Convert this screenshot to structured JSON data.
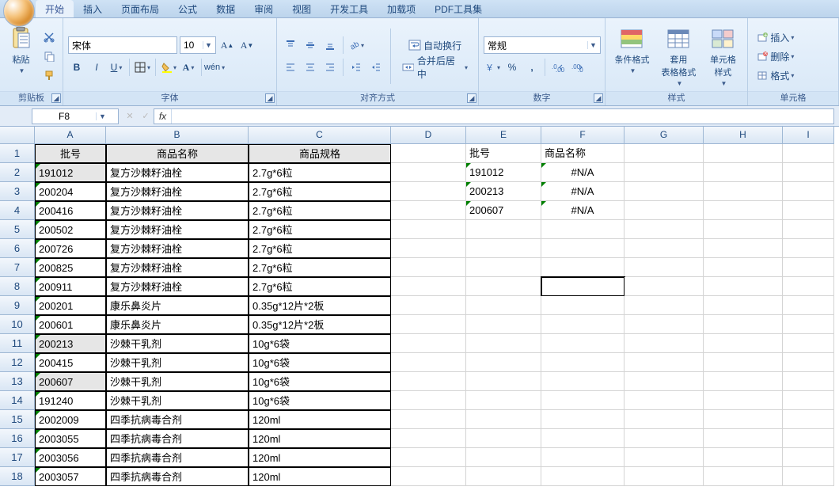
{
  "tabs": [
    "开始",
    "插入",
    "页面布局",
    "公式",
    "数据",
    "审阅",
    "视图",
    "开发工具",
    "加载项",
    "PDF工具集"
  ],
  "active_tab": 0,
  "ribbon": {
    "clipboard": {
      "title": "剪贴板",
      "paste": "粘贴"
    },
    "font": {
      "title": "字体",
      "name": "宋体",
      "size": "10"
    },
    "align": {
      "title": "对齐方式",
      "wrap": "自动换行",
      "merge": "合并后居中"
    },
    "number": {
      "title": "数字",
      "format": "常规"
    },
    "styles": {
      "title": "样式",
      "cond": "条件格式",
      "table": "套用\n表格格式",
      "cell": "单元格\n样式"
    },
    "cells": {
      "title": "单元格",
      "insert": "插入",
      "delete": "删除",
      "format": "格式"
    }
  },
  "namebox": "F8",
  "formula": "",
  "columns": [
    "A",
    "B",
    "C",
    "D",
    "E",
    "F",
    "G",
    "H",
    "I"
  ],
  "col_widths": {
    "A": 90,
    "B": 180,
    "C": 180,
    "D": 95,
    "E": 95,
    "F": 105,
    "G": 100,
    "H": 100,
    "I": 65
  },
  "row_count": 18,
  "headers1": {
    "A": "批号",
    "B": "商品名称",
    "C": "商品规格"
  },
  "headers2": {
    "E": "批号",
    "F": "商品名称"
  },
  "table1": [
    {
      "a": "191012",
      "b": "复方沙棘籽油栓",
      "c": "2.7g*6粒",
      "hl": true
    },
    {
      "a": "200204",
      "b": "复方沙棘籽油栓",
      "c": "2.7g*6粒"
    },
    {
      "a": "200416",
      "b": "复方沙棘籽油栓",
      "c": "2.7g*6粒"
    },
    {
      "a": "200502",
      "b": "复方沙棘籽油栓",
      "c": "2.7g*6粒"
    },
    {
      "a": "200726",
      "b": "复方沙棘籽油栓",
      "c": "2.7g*6粒"
    },
    {
      "a": "200825",
      "b": "复方沙棘籽油栓",
      "c": "2.7g*6粒"
    },
    {
      "a": "200911",
      "b": "复方沙棘籽油栓",
      "c": "2.7g*6粒"
    },
    {
      "a": "200201",
      "b": "康乐鼻炎片",
      "c": "0.35g*12片*2板"
    },
    {
      "a": "200601",
      "b": "康乐鼻炎片",
      "c": "0.35g*12片*2板"
    },
    {
      "a": "200213",
      "b": "沙棘干乳剂",
      "c": "10g*6袋",
      "hl": true
    },
    {
      "a": "200415",
      "b": "沙棘干乳剂",
      "c": "10g*6袋"
    },
    {
      "a": "200607",
      "b": "沙棘干乳剂",
      "c": "10g*6袋",
      "hl": true
    },
    {
      "a": "191240",
      "b": "沙棘干乳剂",
      "c": "10g*6袋"
    },
    {
      "a": "2002009",
      "b": "四季抗病毒合剂",
      "c": "120ml"
    },
    {
      "a": "2003055",
      "b": "四季抗病毒合剂",
      "c": "120ml"
    },
    {
      "a": "2003056",
      "b": "四季抗病毒合剂",
      "c": "120ml"
    },
    {
      "a": "2003057",
      "b": "四季抗病毒合剂",
      "c": "120ml"
    }
  ],
  "table2": [
    {
      "e": "191012",
      "f": "#N/A"
    },
    {
      "e": "200213",
      "f": "#N/A"
    },
    {
      "e": "200607",
      "f": "#N/A"
    }
  ],
  "active_cell": "F8"
}
